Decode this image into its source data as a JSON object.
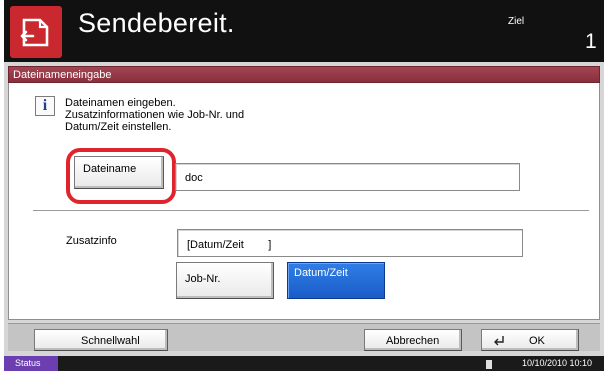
{
  "header": {
    "title": "Sendebereit.",
    "destination_label": "Ziel",
    "destination_count": "1",
    "icon": "send-document-icon"
  },
  "dialog": {
    "title": "Dateinameneingabe",
    "info_icon": "info-icon",
    "info_lines": [
      "Dateinamen eingeben.",
      "Zusatzinformationen wie Job-Nr. und",
      "Datum/Zeit einstellen."
    ],
    "filename_button_label": "Dateiname",
    "filename_value": "doc",
    "additional_info_label": "Zusatzinfo",
    "additional_info_value": "[Datum/Zeit        ]",
    "jobnr_button_label": "Job-Nr.",
    "datetime_button_label": "Datum/Zeit",
    "datetime_button_selected": true
  },
  "footer": {
    "quick_dial_label": "Schnellwahl",
    "cancel_label": "Abbrechen",
    "ok_label": "OK",
    "ok_icon": "enter-arrow-icon"
  },
  "status_bar": {
    "status_label": "Status",
    "datetime": "10/10/2010  10:10"
  },
  "colors": {
    "header_bg": "#111111",
    "header_icon_bg": "#c8282e",
    "dialog_bar": "#8a2f3d",
    "selected_button": "#1a5cc9",
    "highlight_ring": "#e0242c",
    "status_button": "#6b3fb0"
  }
}
